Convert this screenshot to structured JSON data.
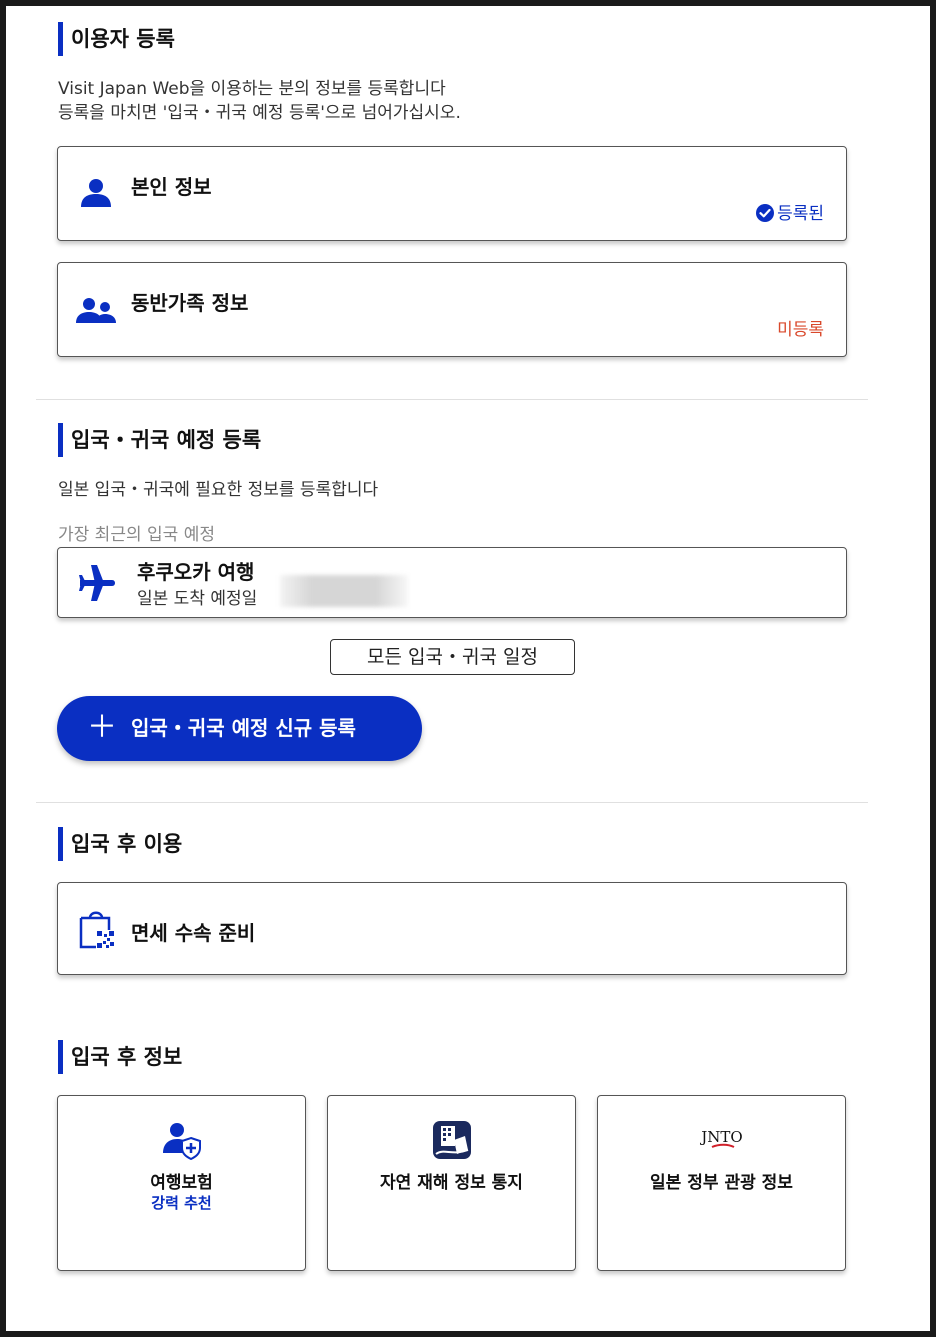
{
  "user_registration": {
    "heading": "이용자 등록",
    "desc_line1": "Visit Japan Web을 이용하는 분의 정보를 등록합니다",
    "desc_line2": "등록을 마치면 '입국・귀국 예정 등록'으로 넘어가십시오.",
    "self_info": {
      "title": "본인 정보",
      "status": "등록된",
      "icon": "person-icon"
    },
    "companion_info": {
      "title": "동반가족 정보",
      "status": "미등록",
      "icon": "people-icon"
    }
  },
  "entry_plan": {
    "heading": "입국・귀국 예정 등록",
    "desc": "일본 입국・귀국에 필요한 정보를 등록합니다",
    "recent_label": "가장 최근의 입국 예정",
    "trip": {
      "title": "후쿠오카 여행",
      "arrival_label": "일본 도착 예정일",
      "icon": "airplane-icon"
    },
    "all_schedules_button": "모든 입국・귀국 일정",
    "new_registration_button": "입국・귀국 예정 신규 등록"
  },
  "after_entry_use": {
    "heading": "입국 후 이용",
    "tax_free": {
      "title": "면세 수속 준비",
      "icon": "shopping-bag-qr-icon"
    }
  },
  "after_entry_info": {
    "heading": "입국 후 정보",
    "tiles": [
      {
        "label": "여행보험",
        "sub": "강력 추천",
        "icon": "insurance-shield-icon"
      },
      {
        "label": "자연 재해 정보 통지",
        "sub": "",
        "icon": "disaster-app-icon"
      },
      {
        "label": "일본 정부 관광 정보",
        "sub": "",
        "icon": "jnto-logo-icon",
        "logo_text": "JNTO"
      }
    ]
  },
  "colors": {
    "accent": "#0a2fc2",
    "registered": "#0a2fc2",
    "unregistered": "#d9482b"
  }
}
